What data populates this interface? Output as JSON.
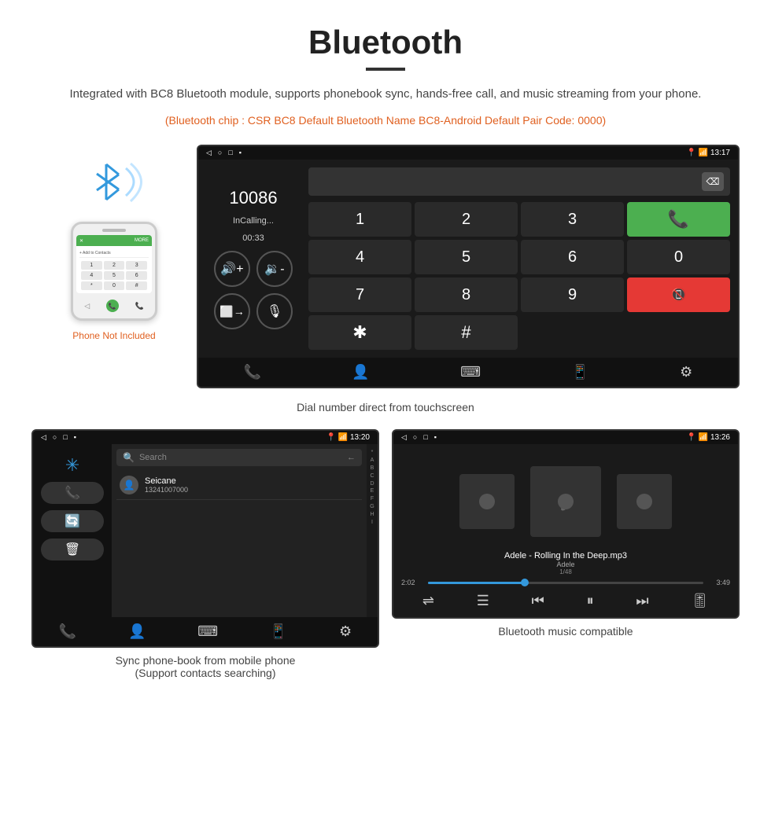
{
  "page": {
    "title": "Bluetooth",
    "subtitle": "Integrated with BC8 Bluetooth module, supports phonebook sync, hands-free call, and music streaming from your phone.",
    "orange_text": "(Bluetooth chip : CSR BC8    Default Bluetooth Name BC8-Android    Default Pair Code: 0000)",
    "caption_dialer": "Dial number direct from touchscreen",
    "caption_phonebook": "Sync phone-book from mobile phone\n(Support contacts searching)",
    "caption_music": "Bluetooth music compatible"
  },
  "dialer": {
    "statusbar_time": "13:17",
    "call_number": "10086",
    "call_status": "InCalling...",
    "call_timer": "00:33",
    "keys": [
      "1",
      "2",
      "3",
      "★",
      "",
      "4",
      "5",
      "6",
      "0",
      "",
      "7",
      "8",
      "9",
      "#",
      ""
    ]
  },
  "phonebook": {
    "statusbar_time": "13:20",
    "search_placeholder": "Search",
    "contact_name": "Seicane",
    "contact_number": "13241007000",
    "alpha_letters": [
      "*",
      "A",
      "B",
      "C",
      "D",
      "E",
      "F",
      "G",
      "H",
      "I"
    ]
  },
  "music": {
    "statusbar_time": "13:26",
    "song_title": "Adele - Rolling In the Deep.mp3",
    "song_artist": "Adele",
    "song_counter": "1/48",
    "time_current": "2:02",
    "time_total": "3:49"
  },
  "phone_mockup": {
    "not_included": "Phone Not Included"
  },
  "statusbar_icons": {
    "back": "◁",
    "home": "○",
    "recent": "□",
    "notif": "▪"
  }
}
